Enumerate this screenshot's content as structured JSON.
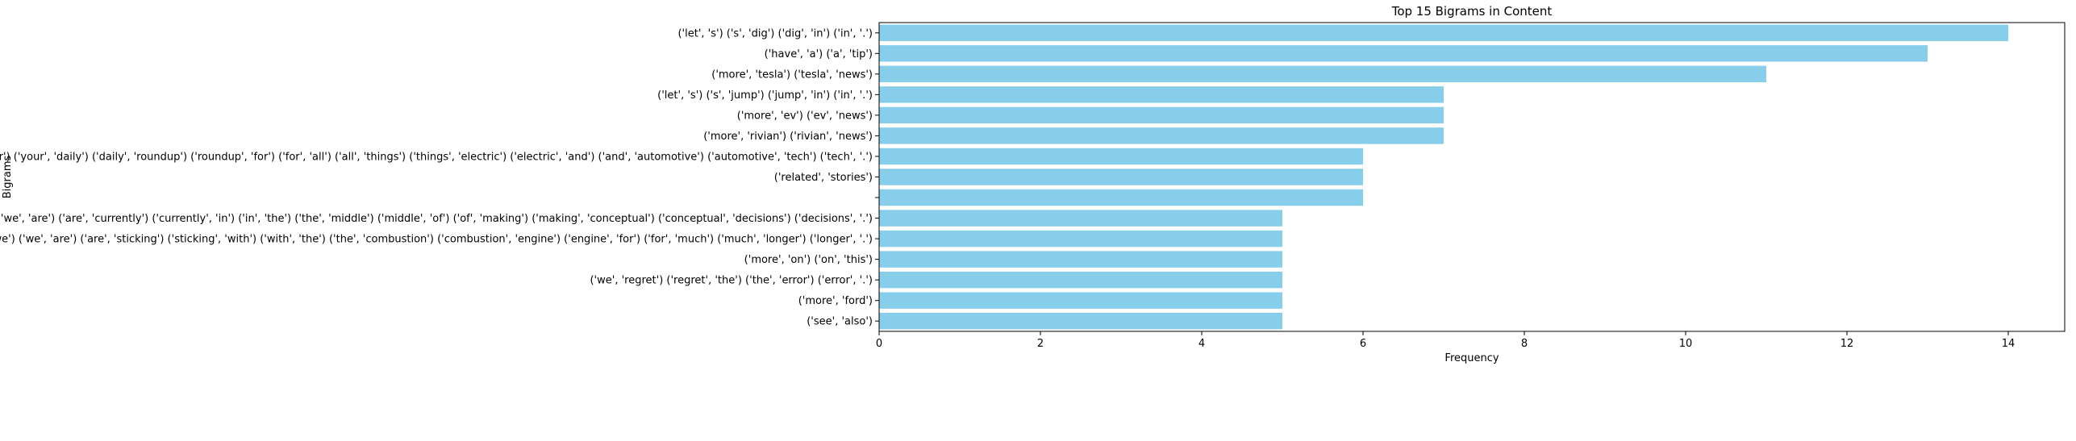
{
  "chart_data": {
    "type": "bar",
    "orientation": "horizontal",
    "title": "Top 15 Bigrams in Content",
    "xlabel": "Frequency",
    "ylabel": "Bigrams",
    "xlim": [
      0,
      14.7
    ],
    "xticks": [
      0,
      2,
      4,
      6,
      8,
      10,
      12,
      14
    ],
    "grid": false,
    "legend": "none",
    "bar_color": "#87CEEB",
    "categories": [
      "('let', 's') ('s', 'dig') ('dig', 'in') ('in', '.')",
      "('have', 'a') ('a', 'tip')",
      "('more', 'tesla') ('tesla', 'news')",
      "('let', 's') ('s', 'jump') ('jump', 'in') ('in', '.')",
      "('more', 'ev') ('ev', 'news')",
      "('more', 'rivian') ('rivian', 'news')",
      "('welcome', 'back') ('back', 'to') ('to', 'critical') ('critical', 'materials') ('materials', 'your') ('your', 'daily') ('daily', 'roundup') ('roundup', 'for') ('for', 'all') ('all', 'things') ('things', 'electric') ('electric', 'and') ('and', 'automotive') ('automotive', 'tech') ('tech', '.')",
      "('related', 'stories')",
      "",
      "('we', 'are') ('are', 'currently') ('currently', 'in') ('in', 'the') ('the', 'middle') ('middle', 'of') ('of', 'making') ('making', 'conceptual') ('conceptual', 'decisions') ('decisions', '.')",
      "('what', 'is') ('is', 'clear') ('clear', 'is') ('is', 'that') ('that', 'we') ('we', 'are') ('are', 'sticking') ('sticking', 'with') ('with', 'the') ('the', 'combustion') ('combustion', 'engine') ('engine', 'for') ('for', 'much') ('much', 'longer') ('longer', '.')",
      "('more', 'on') ('on', 'this')",
      "('we', 'regret') ('regret', 'the') ('the', 'error') ('error', '.')",
      "('more', 'ford')",
      "('see', 'also')"
    ],
    "values": [
      14,
      13,
      11,
      7,
      7,
      7,
      6,
      6,
      6,
      5,
      5,
      5,
      5,
      5,
      5
    ]
  }
}
